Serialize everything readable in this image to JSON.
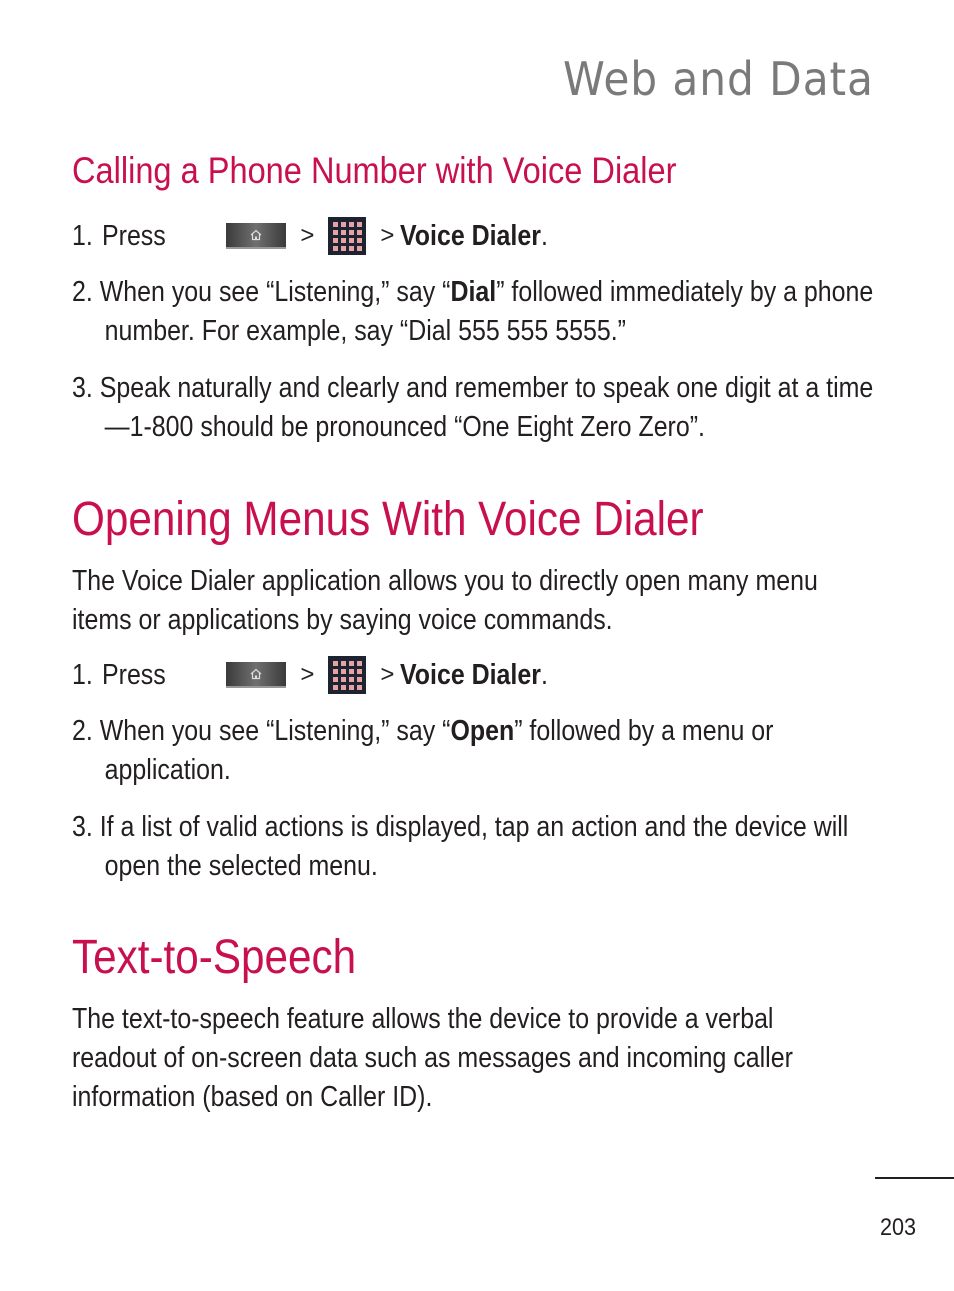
{
  "header": {
    "section_title": "Web and Data"
  },
  "sections": [
    {
      "title": "Calling a Phone Number with Voice Dialer",
      "steps": [
        {
          "number": "1.",
          "press_label": "Press",
          "home_icon": "home-key-icon",
          "separator": ">",
          "apps_icon": "apps-grid-icon",
          "target_separator": ">",
          "target": "Voice Dialer",
          "end": "."
        },
        {
          "number": "2.",
          "before": "When you see “Listening,” say “",
          "bold": "Dial",
          "after": "” followed immediately by a phone number. For example, say “Dial 555 555 5555.”"
        },
        {
          "number": "3.",
          "text": "Speak naturally and clearly and remember to speak one digit at a time—1-800 should be pronounced “One Eight Zero Zero”."
        }
      ]
    },
    {
      "title": "Opening Menus With Voice Dialer",
      "intro": "The Voice Dialer application allows you to directly open many menu items or applications by saying voice commands.",
      "steps": [
        {
          "number": "1.",
          "press_label": "Press",
          "home_icon": "home-key-icon",
          "separator": ">",
          "apps_icon": "apps-grid-icon",
          "target_separator": ">",
          "target": "Voice Dialer",
          "end": "."
        },
        {
          "number": "2.",
          "before": "When you see “Listening,” say “",
          "bold": "Open",
          "after": "” followed by a menu or application."
        },
        {
          "number": "3.",
          "text": "If a list of valid actions is displayed, tap an action and the device will open the selected menu."
        }
      ]
    },
    {
      "title": "Text-to-Speech",
      "intro": "The text-to-speech feature allows the device to provide a verbal readout of on-screen data such as messages and incoming caller information (based on Caller ID)."
    }
  ],
  "footer": {
    "page_number": "203"
  },
  "colors": {
    "heading": "#c8104e",
    "section_header": "#7a7a7a",
    "body_text": "#231f20"
  }
}
